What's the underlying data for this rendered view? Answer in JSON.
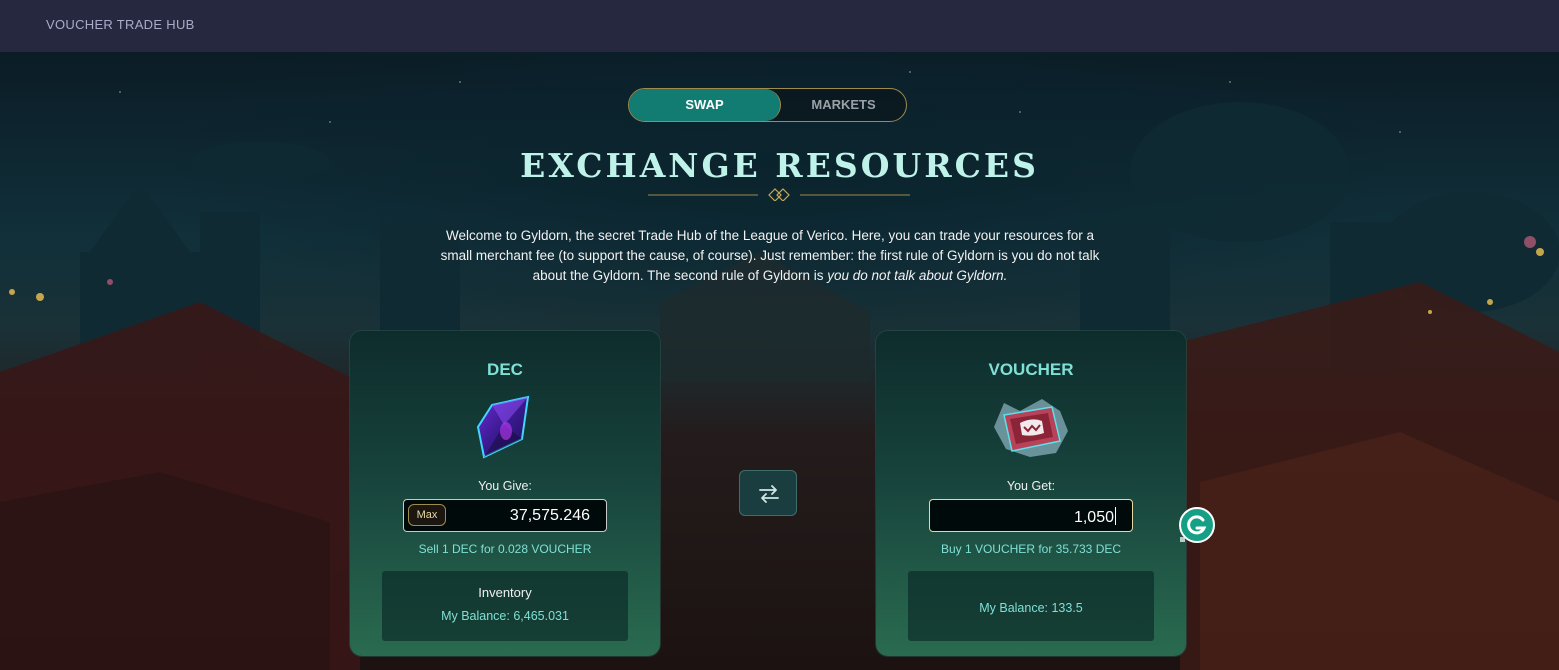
{
  "topbar": {
    "title": "VOUCHER TRADE HUB"
  },
  "tabs": {
    "swap": "SWAP",
    "markets": "MARKETS"
  },
  "heading": "EXCHANGE RESOURCES",
  "intro": {
    "text": "Welcome to Gyldorn, the secret Trade Hub of the League of Verico. Here, you can trade your resources for a small merchant fee (to support the cause, of course). Just remember: the first rule of Gyldorn is you do not talk about the Gyldorn. The second rule of Gyldorn is ",
    "emphasis": "you do not talk about Gyldorn."
  },
  "give": {
    "token": "DEC",
    "label": "You Give:",
    "max_label": "Max",
    "amount": "37,575.246",
    "rate": "Sell 1 DEC for 0.028 VOUCHER",
    "inventory_title": "Inventory",
    "balance": "My Balance: 6,465.031"
  },
  "get": {
    "token": "VOUCHER",
    "label": "You Get:",
    "amount": "1,050",
    "rate": "Buy 1 VOUCHER for 35.733 DEC",
    "balance": "My Balance: 133.5"
  },
  "colors": {
    "accent": "#127b72",
    "teal_text": "#7fe0d6",
    "gold_border": "#a08b4c",
    "topbar": "#25283f"
  },
  "icons": {
    "swap": "swap-arrows-icon",
    "dec": "dec-crystal-icon",
    "voucher": "voucher-ticket-icon",
    "grammarly": "grammarly-icon"
  }
}
